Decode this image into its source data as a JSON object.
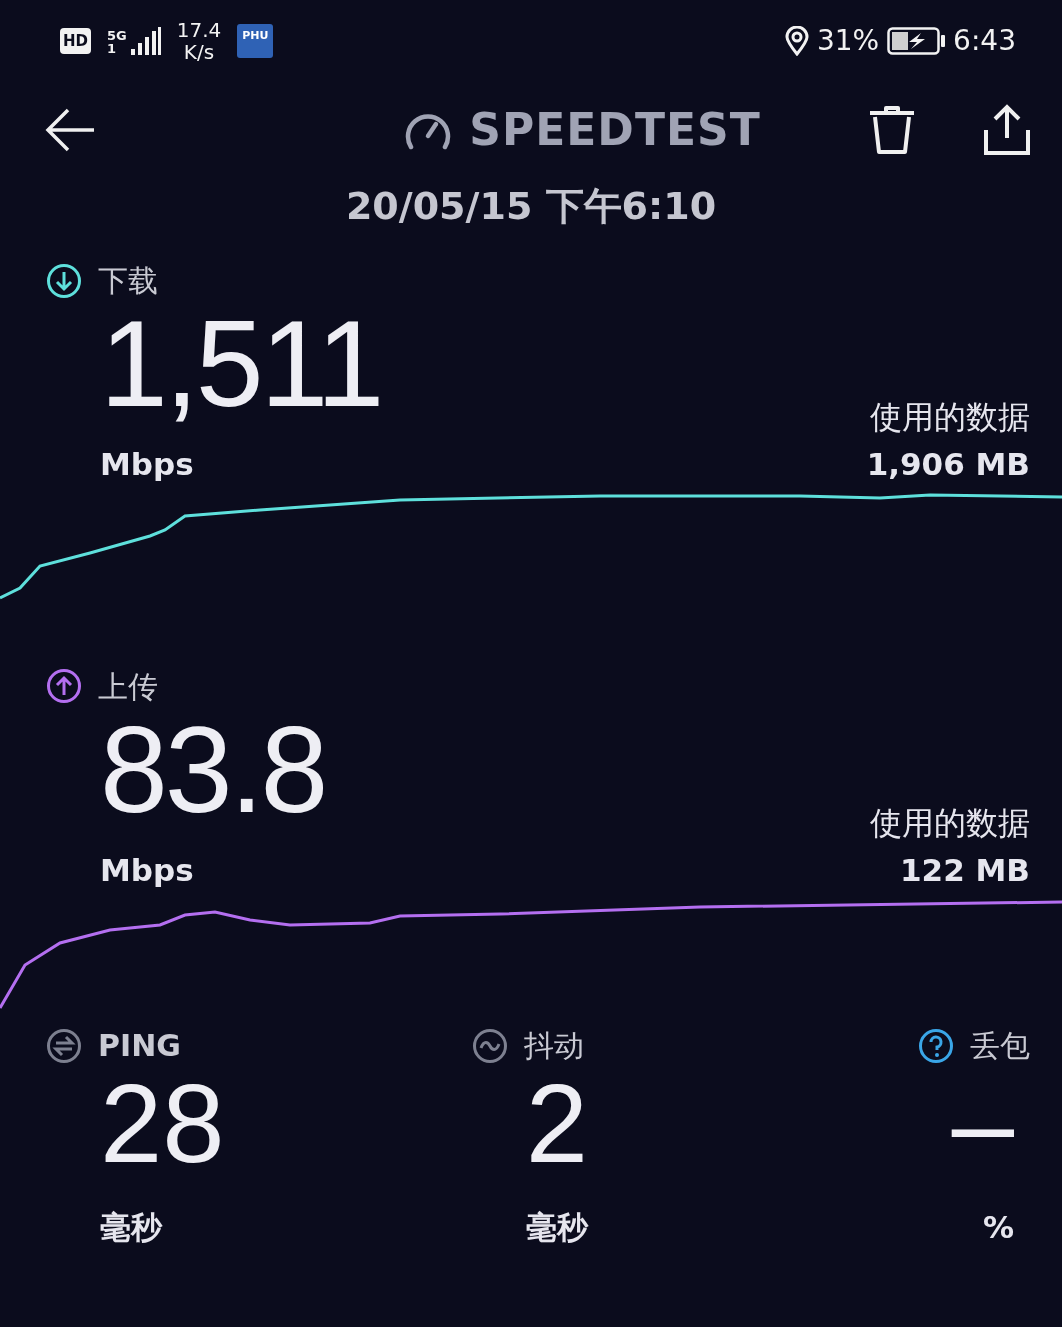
{
  "status_bar": {
    "hd": "HD",
    "network": "5G",
    "network_sub": "1",
    "speed": "17.4",
    "speed_unit": "K/s",
    "app_badge": "PHU",
    "battery": "31%",
    "time": "6:43"
  },
  "header": {
    "title": "SPEEDTEST",
    "date": "20/05/15 下午6:10"
  },
  "results": [
    {
      "kind": "download",
      "label": "下载",
      "value": "1,511",
      "unit": "Mbps",
      "data_label": "使用的数据",
      "data_value": "1,906 MB",
      "color": "#5ee0dc"
    },
    {
      "kind": "upload",
      "label": "上传",
      "value": "83.8",
      "unit": "Mbps",
      "data_label": "使用的数据",
      "data_value": "122 MB",
      "color": "#b46ff0"
    }
  ],
  "metrics": [
    {
      "kind": "ping",
      "label": "PING",
      "value": "28",
      "unit": "毫秒"
    },
    {
      "kind": "jitter",
      "label": "抖动",
      "value": "2",
      "unit": "毫秒"
    },
    {
      "kind": "loss",
      "label": "丢包",
      "value": "–",
      "unit": "%"
    }
  ]
}
